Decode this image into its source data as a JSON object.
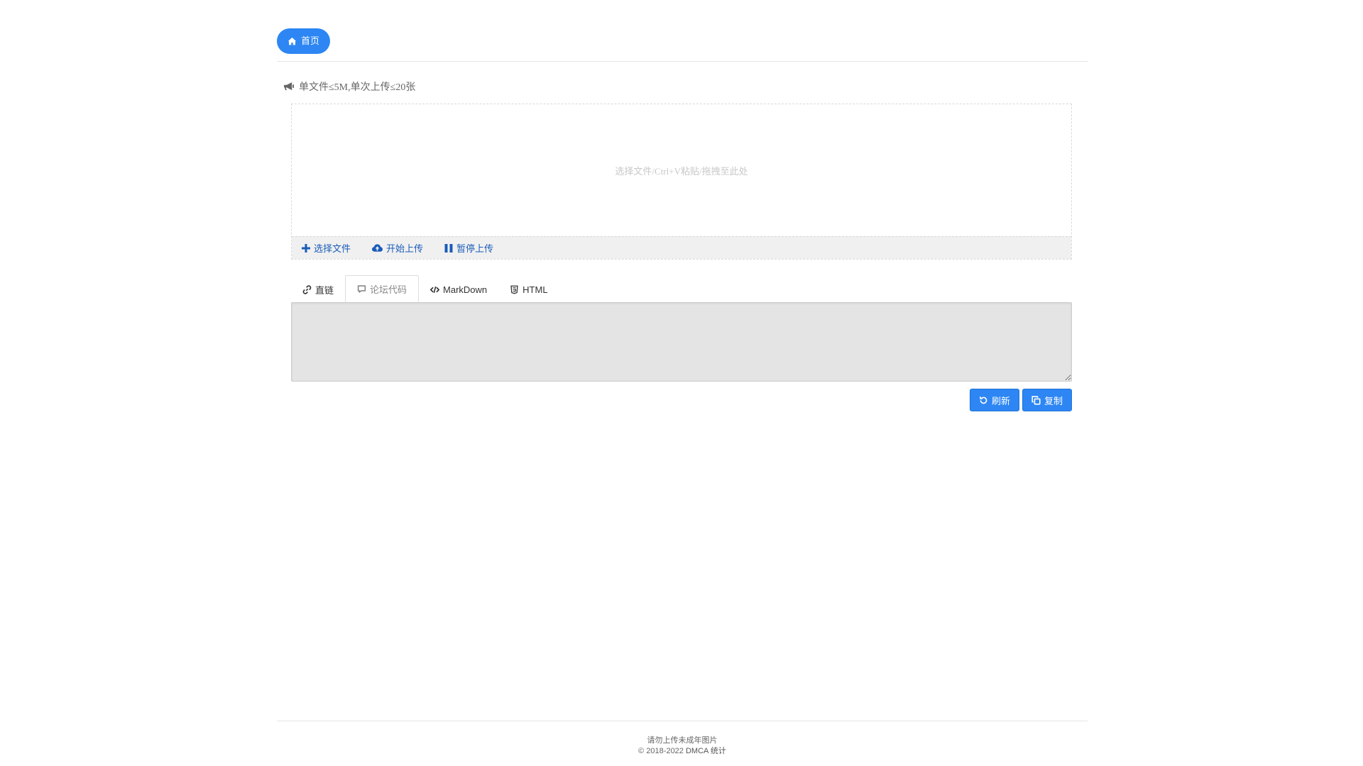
{
  "header": {
    "home_label": "首页"
  },
  "notice": {
    "text": "单文件≤5M,单次上传≤20张"
  },
  "upload": {
    "drop_hint": "选择文件/Ctrl+V粘贴/拖拽至此处",
    "select_label": "选择文件",
    "start_label": "开始上传",
    "pause_label": "暂停上传"
  },
  "tabs": [
    {
      "label": "直链",
      "icon": "link-icon",
      "active": false
    },
    {
      "label": "论坛代码",
      "icon": "comment-icon",
      "active": true
    },
    {
      "label": "MarkDown",
      "icon": "code-icon",
      "active": false
    },
    {
      "label": "HTML",
      "icon": "html5-icon",
      "active": false
    }
  ],
  "output": {
    "value": ""
  },
  "actions": {
    "refresh_label": "刷新",
    "copy_label": "复制"
  },
  "footer": {
    "warning": "请勿上传未成年图片",
    "copyright": "© 2018-2022",
    "dmca": "DMCA",
    "stats": "统计"
  },
  "colors": {
    "accent": "#2d86f3",
    "toolbar_link": "#1a5cb8",
    "output_bg": "#e4e4e4"
  }
}
